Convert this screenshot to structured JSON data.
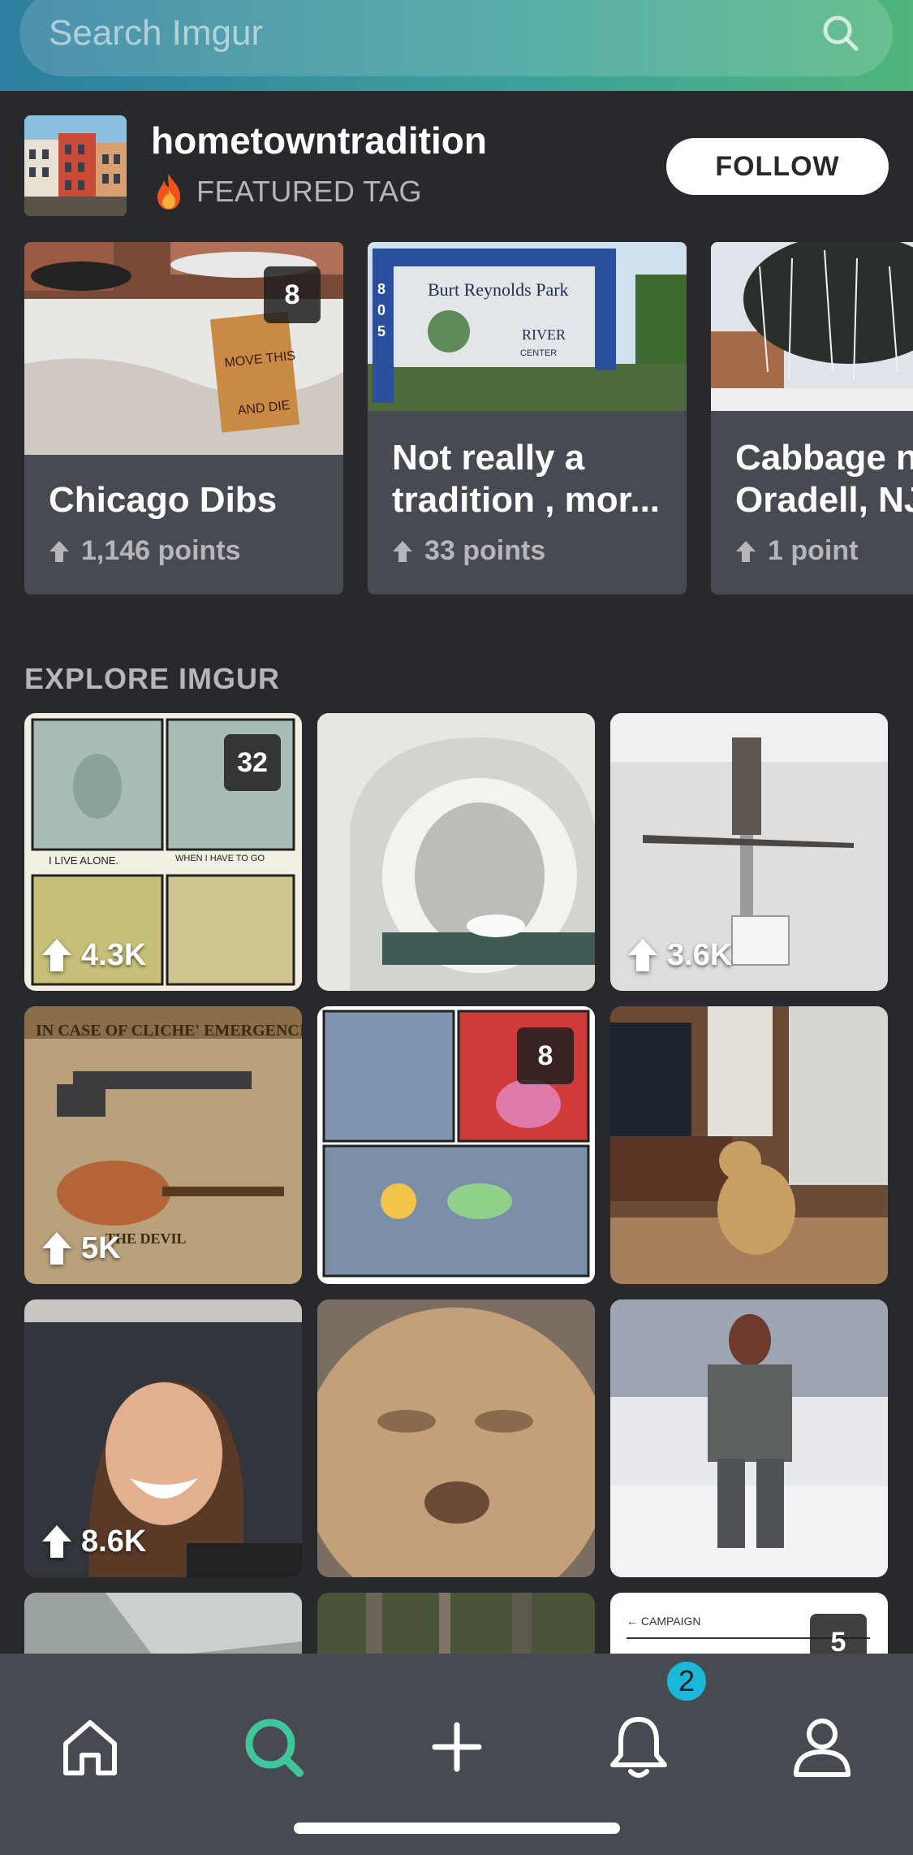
{
  "search": {
    "placeholder": "Search Imgur"
  },
  "featured_tag": {
    "name": "hometowntradition",
    "subtitle": "FEATURED TAG",
    "follow_label": "FOLLOW",
    "cards": [
      {
        "title_lines": [
          "Chicago Dibs"
        ],
        "points": "1,146 points",
        "count": "8"
      },
      {
        "title_lines": [
          "Not really a",
          "tradition , mor..."
        ],
        "points": "33 points",
        "count": ""
      },
      {
        "title_lines": [
          "Cabbage n",
          "Oradell, NJ"
        ],
        "points": "1 point",
        "count": ""
      }
    ]
  },
  "explore": {
    "heading": "EXPLORE IMGUR",
    "tiles": [
      {
        "score": "4.3K",
        "count": "32"
      },
      {
        "score": "",
        "count": ""
      },
      {
        "score": "3.6K",
        "count": ""
      },
      {
        "score": "5K",
        "count": ""
      },
      {
        "score": "",
        "count": "8"
      },
      {
        "score": "",
        "count": ""
      },
      {
        "score": "8.6K",
        "count": ""
      },
      {
        "score": "",
        "count": ""
      },
      {
        "score": "",
        "count": ""
      },
      {
        "score": "",
        "count": ""
      },
      {
        "score": "",
        "count": ""
      },
      {
        "score": "",
        "count": "5"
      }
    ]
  },
  "nav": {
    "items": [
      "home-icon",
      "search-icon",
      "plus-icon",
      "bell-icon",
      "profile-icon"
    ],
    "active": "search-icon",
    "notification_count": "2"
  },
  "colors": {
    "accent": "#3fc69a",
    "badge": "#1bb7d8",
    "background": "#27292d",
    "nav": "#474a51"
  }
}
